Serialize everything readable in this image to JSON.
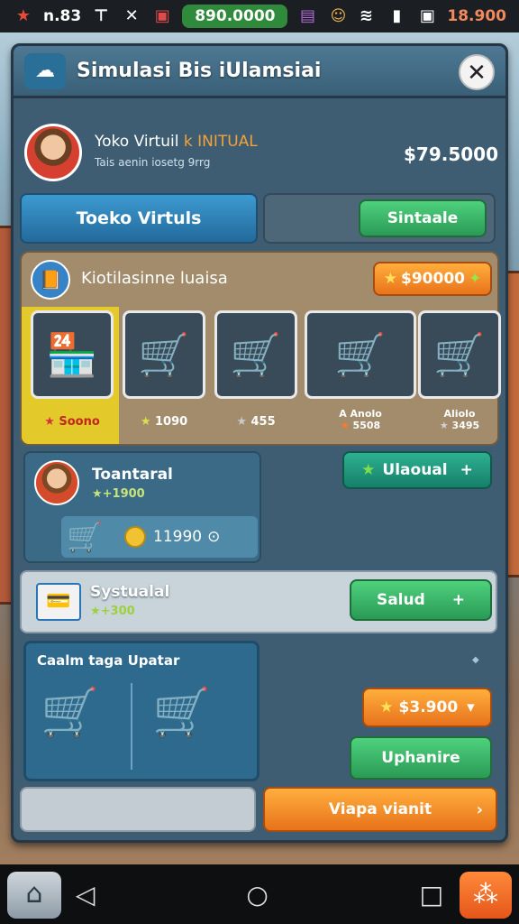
{
  "status_bar": {
    "left_text": "n.83",
    "center_value": "890.0000",
    "right_value": "18.900"
  },
  "window": {
    "title": "Simulasi Bis iUlamsiai",
    "close_icon": "close-icon"
  },
  "profile": {
    "name": "Yoko Virtuil",
    "tag": "k INITUAL",
    "subtitle": "Tais aenin iosetg 9rrg",
    "balance": "$79.5000"
  },
  "tabs": {
    "main_label": "Toeko Virtuls",
    "side_button": "Sintaale"
  },
  "shop": {
    "title": "Kiotilasinne luaisa",
    "price": "$90000",
    "items": [
      {
        "icon": "vending-cart-icon",
        "glyph": "🏪",
        "label": "Soono"
      },
      {
        "icon": "cart-groceries-icon",
        "glyph": "🛒",
        "label": "1090"
      },
      {
        "icon": "shopping-cart-icon",
        "glyph": "🛒",
        "label": "455"
      },
      {
        "icon": "cart-boxes-icon",
        "glyph": "🛒",
        "label_top": "A Anolo",
        "label": "5508"
      },
      {
        "icon": "cart-food-icon",
        "glyph": "🛒",
        "label_top": "Aliolo",
        "label": "3495"
      }
    ]
  },
  "row1": {
    "name": "Toantaral",
    "sub": "+1900",
    "coins": "11990",
    "button": "Ulaoual"
  },
  "row2": {
    "name": "Systualal",
    "sub": "+300",
    "button": "Salud"
  },
  "upgrade": {
    "title": "Caalm taga Upatar",
    "price": "$3.900",
    "button": "Uphanire"
  },
  "bottom": {
    "button": "Viapa vianit"
  },
  "colors": {
    "panel": "#3f5d72",
    "green": "#2a9a55",
    "orange": "#e8731b",
    "teal": "#16806a",
    "blue": "#236a9b"
  }
}
